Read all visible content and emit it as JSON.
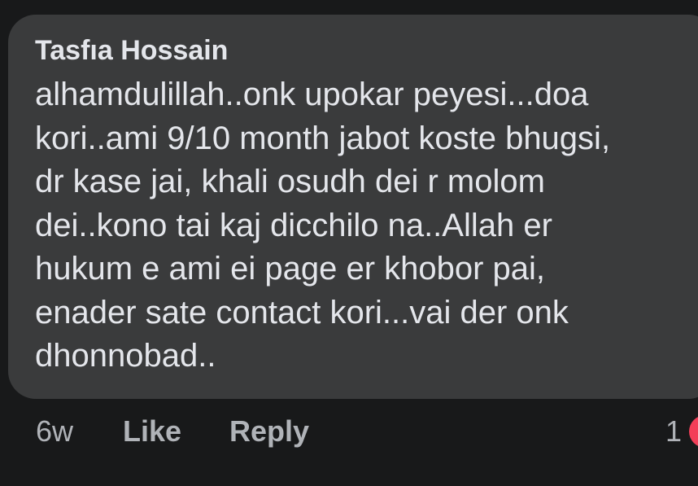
{
  "comment": {
    "author": "Tasfıa Hossain",
    "lines": [
      "alhamdulillah..onk upokar peyesi...doa",
      "kori..ami 9/10 month jabot koste bhugsi,",
      "dr kase jai,  khali osudh dei r molom",
      "dei..kono tai kaj dicchilo na..Allah er",
      "hukum e ami ei page er khobor pai,",
      "enader sate contact kori...vai der onk",
      "dhonnobad.."
    ]
  },
  "actions": {
    "timestamp": "6w",
    "like_label": "Like",
    "reply_label": "Reply",
    "reaction_count": "1",
    "reaction_icon": "love-reaction-icon"
  },
  "colors": {
    "background": "#18191a",
    "bubble": "#3a3b3c",
    "text": "#e4e6eb",
    "secondary_text": "#b0b3b8",
    "reaction": "#f33e58"
  }
}
